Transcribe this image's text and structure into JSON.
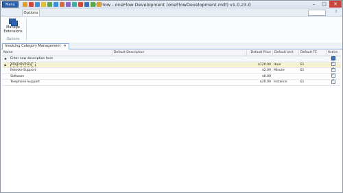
{
  "window": {
    "title": "oneFlow - oneFlow Development (oneFlowDevelopment.mdf) v1.0.23.0"
  },
  "menu": {
    "label": "Menu"
  },
  "quick_access_colors": [
    "#e0a02c",
    "#d24b3a",
    "#3c8fd6",
    "#e0c23a",
    "#5aa84a",
    "#3c8fd6",
    "#d66a3a",
    "#8a6ac6",
    "#3cb0a8",
    "#d24b3a",
    "#3a6fb5",
    "#5aa84a",
    "#e0a02c"
  ],
  "controls": {
    "minimize": "–",
    "maximize": "□",
    "close": "✕"
  },
  "ribbon": {
    "tab": "Options",
    "help": "?",
    "manage_extensions": "Manage Extensions",
    "group": "Options"
  },
  "doctab": {
    "label": "Invoicing Category Management",
    "close": "✕"
  },
  "grid": {
    "columns": {
      "name": "Name",
      "description": "Default Description",
      "price": "Default Price",
      "unit": "Default Unit",
      "tc": "Default TC",
      "active": "Active"
    },
    "new_row": "Enter new description here",
    "rows": [
      {
        "name": "Programming",
        "description": "",
        "price": "$120.00",
        "unit": "Hour",
        "tc": "G1",
        "active": true,
        "selected": true
      },
      {
        "name": "Remote Support",
        "description": "",
        "price": "$2.00",
        "unit": "Minute",
        "tc": "G1",
        "active": true,
        "selected": false
      },
      {
        "name": "Software",
        "description": "",
        "price": "$0.00",
        "unit": "",
        "tc": "",
        "active": true,
        "selected": false
      },
      {
        "name": "Telephone Support",
        "description": "",
        "price": "$20.00",
        "unit": "Instance",
        "tc": "G1",
        "active": true,
        "selected": false
      }
    ]
  }
}
